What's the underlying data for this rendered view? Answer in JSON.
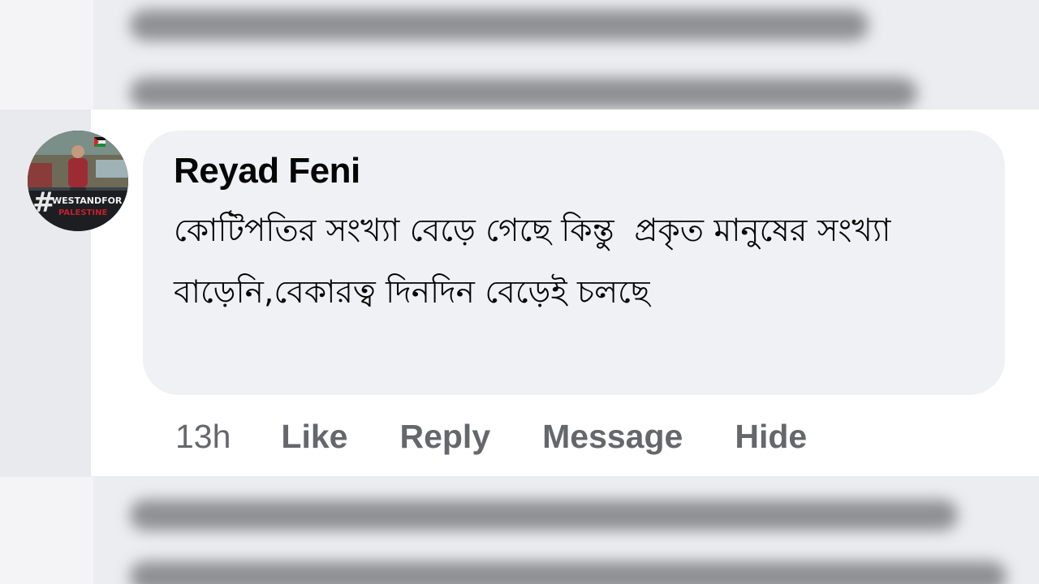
{
  "comment": {
    "author": "Reyad Feni",
    "text": "কোটিপতির সংখ্যা বেড়ে গেছে কিন্তু  প্রকৃত মানুষের সংখ্যা বাড়েনি,বেকারত্ব দিনদিন বেড়েই চলছে",
    "timestamp": "13h",
    "actions": {
      "like": "Like",
      "reply": "Reply",
      "message": "Message",
      "hide": "Hide"
    }
  },
  "avatar": {
    "overlay_text": "#WESTANDFOR PALESTINE"
  },
  "colors": {
    "bubble": "#f0f1f5",
    "action_text": "#65676b",
    "author_text": "#050505"
  }
}
